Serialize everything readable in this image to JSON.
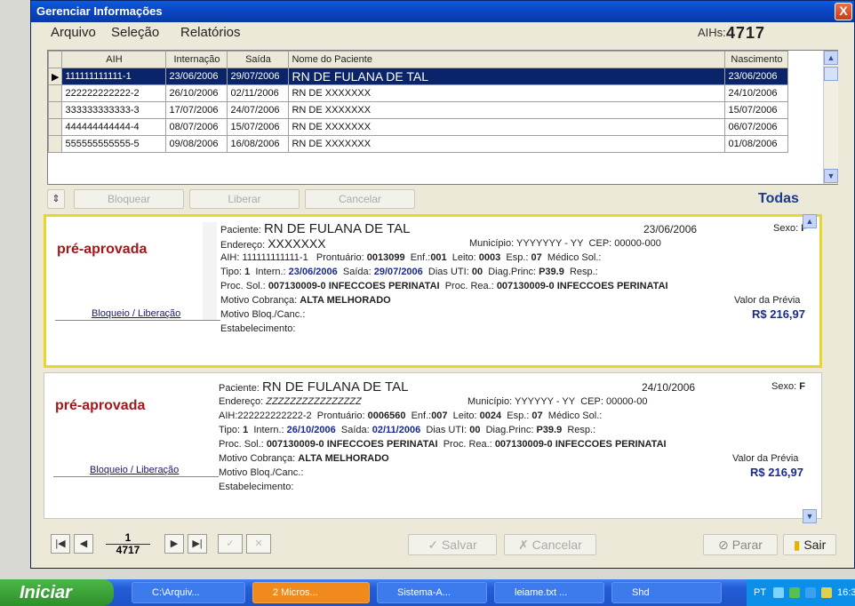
{
  "window": {
    "title": "Gerenciar Informações",
    "close_label": "X"
  },
  "menu": {
    "items": [
      "Arquivo",
      "Seleção",
      "Relatórios"
    ],
    "aihs_label": "AIHs:",
    "aihs_value": "4717"
  },
  "grid": {
    "columns": [
      "AIH",
      "Internação",
      "Saída",
      "Nome do Paciente",
      "Nascimento"
    ],
    "rows": [
      [
        "111111111111-1",
        "23/06/2006",
        "29/07/2006",
        "RN DE FULANA DE TAL",
        "23/06/2006"
      ],
      [
        "222222222222-2",
        "26/10/2006",
        "02/11/2006",
        "RN DE  XXXXXXX",
        "24/10/2006"
      ],
      [
        "333333333333-3",
        "17/07/2006",
        "24/07/2006",
        "RN DE  XXXXXXX",
        "15/07/2006"
      ],
      [
        "444444444444-4",
        "08/07/2006",
        "15/07/2006",
        "RN DE  XXXXXXX",
        "06/07/2006"
      ],
      [
        "555555555555-5",
        "09/08/2006",
        "16/08/2006",
        "RN DE  XXXXXXX",
        "01/08/2006"
      ]
    ],
    "selected_row": 0
  },
  "actions": {
    "bloquear": "Bloquear",
    "liberar": "Liberar",
    "cancelar": "Cancelar",
    "filter": "Todas"
  },
  "cards": [
    {
      "status": "pré-aprovada",
      "bloqueio_link": "Bloqueio / Liberação",
      "paciente_label": "Paciente:",
      "paciente": "RN DE FULANA DE TAL",
      "nascimento": "23/06/2006",
      "sexo_label": "Sexo:",
      "sexo": "F",
      "endereco_label": "Endereço:",
      "endereco": "XXXXXXX",
      "municipio_label": "Município:",
      "municipio": "YYYYYYY - YY",
      "cep_label": "CEP:",
      "cep": "00000-000",
      "aih_label": "AIH:",
      "aih": "111111111111-1",
      "prontuario_label": "Prontuário:",
      "prontuario": "0013099",
      "enf_label": "Enf.:",
      "enf": "001",
      "leito_label": "Leito:",
      "leito": "0003",
      "esp_label": "Esp.:",
      "esp": "07",
      "medico_label": "Médico Sol.:",
      "tipo_label": "Tipo:",
      "tipo": "1",
      "intern_label": "Intern.:",
      "intern": "23/06/2006",
      "saida_label": "Saída:",
      "saida": "29/07/2006",
      "uti_label": "Dias UTI:",
      "uti": "00",
      "diag_label": "Diag.Princ:",
      "diag": "P39.9",
      "resp_label": "Resp.:",
      "procsol_label": "Proc. Sol.:",
      "procsol": "007130009-0 INFECCOES PERINATAI",
      "procrea_label": "Proc. Rea.:",
      "procrea": "007130009-0 INFECCOES PERINATAI",
      "motivo_label": "Motivo Cobrança:",
      "motivo": "ALTA MELHORADO",
      "valor_label": "Valor da Prévia",
      "valor": "R$ 216,97",
      "bloqcanc_label": "Motivo Bloq./Canc.:",
      "estab_label": "Estabelecimento:"
    },
    {
      "status": "pré-aprovada",
      "bloqueio_link": "Bloqueio / Liberação",
      "paciente_label": "Paciente:",
      "paciente": "RN DE FULANA DE TAL",
      "nascimento": "24/10/2006",
      "sexo_label": "Sexo:",
      "sexo": "F",
      "endereco_label": "Endereço:",
      "endereco": "ZZZZZZZZZZZZZZZZ",
      "municipio_label": "Município:",
      "municipio": "YYYYYY - YY",
      "cep_label": "CEP:",
      "cep": "00000-00",
      "aih_label": "AIH:",
      "aih": "222222222222-2",
      "prontuario_label": "Prontuário:",
      "prontuario": "0006560",
      "enf_label": "Enf.:",
      "enf": "007",
      "leito_label": "Leito:",
      "leito": "0024",
      "esp_label": "Esp.:",
      "esp": "07",
      "medico_label": "Médico Sol.:",
      "tipo_label": "Tipo:",
      "tipo": "1",
      "intern_label": "Intern.:",
      "intern": "26/10/2006",
      "saida_label": "Saída:",
      "saida": "02/11/2006",
      "uti_label": "Dias UTI:",
      "uti": "00",
      "diag_label": "Diag.Princ:",
      "diag": "P39.9",
      "resp_label": "Resp.:",
      "procsol_label": "Proc. Sol.:",
      "procsol": "007130009-0 INFECCOES PERINATAI",
      "procrea_label": "Proc. Rea.:",
      "procrea": "007130009-0 INFECCOES PERINATAI",
      "motivo_label": "Motivo Cobrança:",
      "motivo": "ALTA MELHORADO",
      "valor_label": "Valor da Prévia",
      "valor": "R$ 216,97",
      "bloqcanc_label": "Motivo Bloq./Canc.:",
      "estab_label": "Estabelecimento:"
    }
  ],
  "nav": {
    "record_current": "1",
    "record_total": "4717",
    "salvar": "Salvar",
    "cancelar": "Cancelar",
    "parar": "Parar",
    "sair": "Sair"
  },
  "taskbar": {
    "start": "Iniciar",
    "tasks": [
      "C:\\Arquiv...",
      "2 Micros...",
      "Sistema-A...",
      "leiame.txt ...",
      "Shd"
    ],
    "active_task": 1,
    "tray_lang": "PT",
    "clock": "16:3"
  },
  "colors": {
    "status_red": "#a3161b",
    "selected_row": "#0a246a",
    "card_highlight": "#e8d728",
    "value_blue": "#1a2a8a"
  }
}
